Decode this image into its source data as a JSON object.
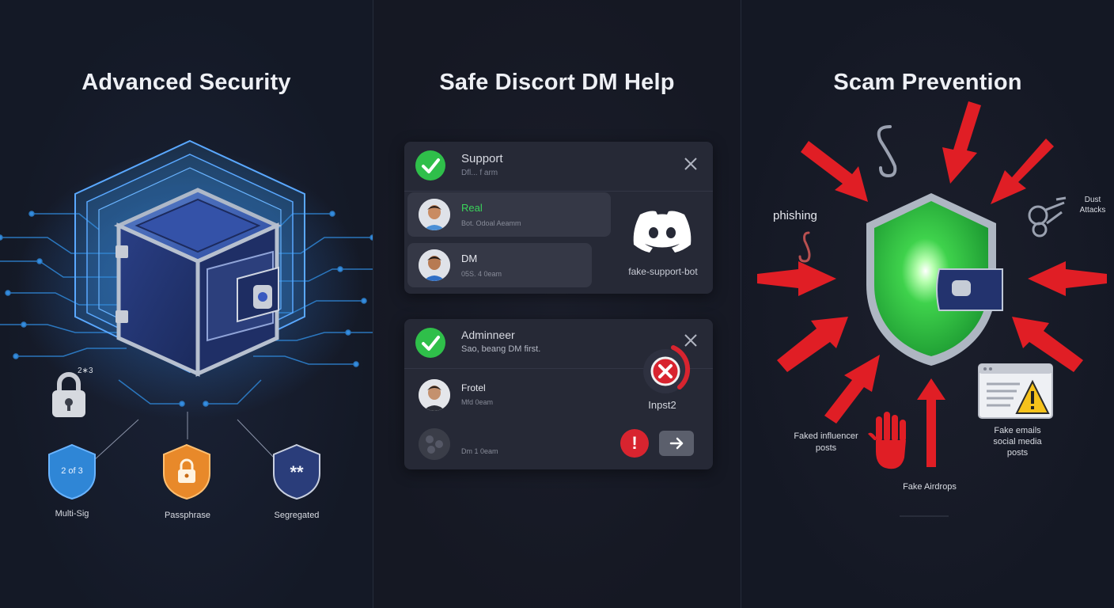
{
  "panels": [
    {
      "title": "Advanced Security"
    },
    {
      "title": "Safe Discort DM Help"
    },
    {
      "title": "Scam Prevention"
    }
  ],
  "security": {
    "lock_badge": "2∗3",
    "shields": [
      {
        "glyph": "2 of 3",
        "label": "Multi-Sig",
        "color": "#2f86d6"
      },
      {
        "glyph": "",
        "label": "Passphrase",
        "color": "#e8892a"
      },
      {
        "glyph": "**",
        "label": "Segregated",
        "color": "#2a3d7a"
      }
    ],
    "accent": "#3a8fe0"
  },
  "dm_help": {
    "card1": {
      "title": "Support",
      "subtitle": "Dfl... f  arm",
      "rows": [
        {
          "name": "Real",
          "sub": "Bot. Odoal Aeamm",
          "name_color": "#3ad45a"
        },
        {
          "name": "DM",
          "sub": "05S. 4 0eam"
        }
      ],
      "side_label": "fake-support-bot"
    },
    "card2": {
      "title": "Adminneer",
      "subtitle": "Sao, beang DM first.",
      "rows": [
        {
          "name": "Frotel",
          "sub": "Mfd 0eam"
        },
        {
          "name": "",
          "sub": "Dm 1 0eam"
        }
      ],
      "side_label": "Inpst2"
    }
  },
  "scam": {
    "labels": {
      "phishing": "phishing",
      "dust": "Dust\nAttacks",
      "influencer": "Faked influencer\nposts",
      "airdrops": "Fake Airdrops",
      "emails": "Fake emails\nsocial media\nposts"
    },
    "arrow_color": "#e01e25",
    "shield_color": "#2fbf4a"
  }
}
